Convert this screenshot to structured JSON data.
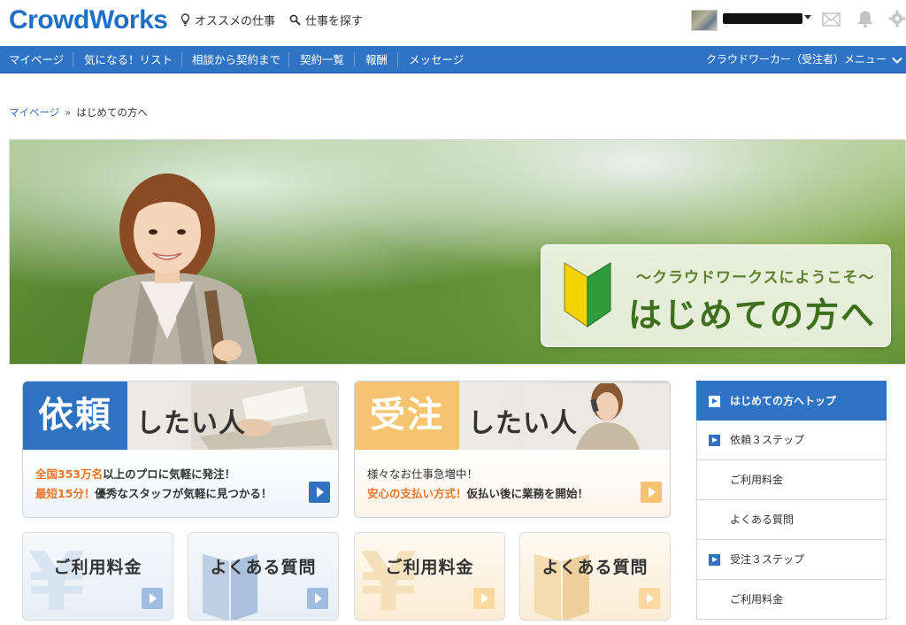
{
  "header": {
    "logo": "CrowdWorks",
    "recommended_jobs": "オススメの仕事",
    "find_jobs": "仕事を探す"
  },
  "nav": {
    "items": [
      "マイページ",
      "気になる！リスト",
      "相談から契約まで",
      "契約一覧",
      "報酬",
      "メッセージ"
    ],
    "menu": "クラウドワーカー（受注者）メニュー"
  },
  "breadcrumb": {
    "home": "マイページ",
    "separator": "»",
    "current": "はじめての方へ"
  },
  "hero": {
    "subtitle": "〜クラウドワークスにようこそ〜",
    "title": "はじめての方へ"
  },
  "cards": {
    "client": {
      "label": "依頼",
      "suffix": "したい人",
      "line1_highlight": "全国353万名",
      "line1_rest": "以上のプロに気軽に発注！",
      "line2_highlight": "最短15分！",
      "line2_rest": "優秀なスタッフが気軽に見つかる！"
    },
    "worker": {
      "label": "受注",
      "suffix": "したい人",
      "line1": "様々なお仕事急増中！",
      "line2_highlight": "安心の支払い方式！",
      "line2_rest": "仮払い後に業務を開始！"
    }
  },
  "small_cards": {
    "client_fee": "ご利用料金",
    "client_faq": "よくある質問",
    "worker_fee": "ご利用料金",
    "worker_faq": "よくある質問",
    "yen_symbol": "¥"
  },
  "sidebar": {
    "items": [
      {
        "label": "はじめての方へトップ"
      },
      {
        "label": "依頼３ステップ"
      },
      {
        "label": "ご利用料金"
      },
      {
        "label": "よくある質問"
      },
      {
        "label": "受注３ステップ"
      },
      {
        "label": "ご利用料金"
      }
    ]
  },
  "colors": {
    "brand_blue": "#2f74c4",
    "accent_orange": "#f6c370",
    "highlight_orange": "#e8752a"
  }
}
